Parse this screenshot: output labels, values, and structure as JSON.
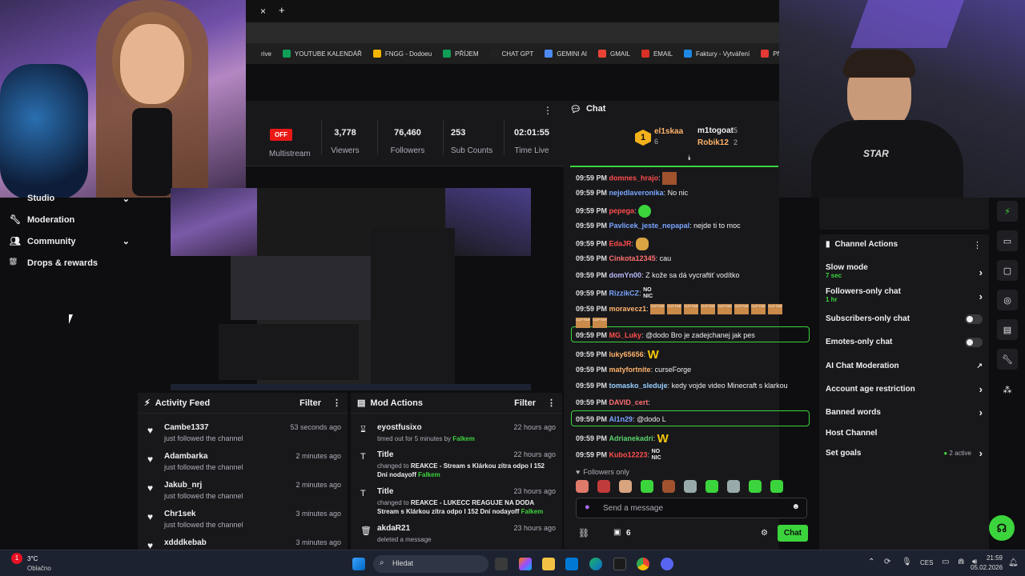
{
  "browser": {
    "new_tab": "+",
    "close_tab": "×",
    "bookmarks": [
      {
        "label": "rive",
        "color": "#1f1f1f"
      },
      {
        "label": "YOUTUBE KALENDÁŘ",
        "color": "#0f9d58"
      },
      {
        "label": "FNGG - Dodoeu",
        "color": "#f4b400"
      },
      {
        "label": "PŘÍJEM",
        "color": "#0f9d58"
      },
      {
        "label": "CHAT GPT",
        "color": "#222222"
      },
      {
        "label": "GEMINI AI",
        "color": "#4c8bf5"
      },
      {
        "label": "GMAIL",
        "color": "#ea4335"
      },
      {
        "label": "EMAIL",
        "color": "#d93025"
      },
      {
        "label": "Faktury - Vytváření",
        "color": "#1e88e5"
      },
      {
        "label": "PNG to PDF",
        "color": "#e53935"
      }
    ]
  },
  "stats": {
    "status": "OFF",
    "multistream": "Multistream",
    "viewers": {
      "value": "3,778",
      "label": "Viewers"
    },
    "followers": {
      "value": "76,460",
      "label": "Followers"
    },
    "subs": {
      "value": "253",
      "label": "Sub Counts"
    },
    "time": {
      "value": "02:01:55",
      "label": "Time Live"
    }
  },
  "sidebar": {
    "studio": "Studio",
    "moderation": "Moderation",
    "community": "Community",
    "drops": "Drops & rewards"
  },
  "activity": {
    "title": "Activity Feed",
    "filter": "Filter",
    "items": [
      {
        "name": "Cambe1337",
        "sub": "just followed the channel",
        "time": "53 seconds ago"
      },
      {
        "name": "Adambarka",
        "sub": "just followed the channel",
        "time": "2 minutes ago"
      },
      {
        "name": "Jakub_nrj",
        "sub": "just followed the channel",
        "time": "2 minutes ago"
      },
      {
        "name": "Chr1sek",
        "sub": "just followed the channel",
        "time": "3 minutes ago"
      },
      {
        "name": "xdddkebab",
        "sub": "",
        "time": "3 minutes ago"
      }
    ]
  },
  "mod_actions": {
    "title": "Mod Actions",
    "filter": "Filter",
    "items": [
      {
        "name": "eyostfusixo",
        "line1": "timed out for 5 minutes by",
        "by": "Falkem",
        "line2": "",
        "time": "22 hours ago"
      },
      {
        "name": "Title",
        "line1": "changed to",
        "bold1": "REAKCE - Stream s Klárkou zítra odpo I 152",
        "line2": "Dní nodayoff",
        "by": "Falkem",
        "time": "22 hours ago"
      },
      {
        "name": "Title",
        "line1": "changed to",
        "bold1": "REAKCE - LUKECC REAGUJE NA DODA",
        "line2": "Stream s Klárkou zítra odpo I 152 Dní nodayoff",
        "by": "Falkem",
        "time": "23 hours ago"
      },
      {
        "name": "akdaR21",
        "line1": "deleted a message",
        "by": "",
        "line2": "",
        "time": "23 hours ago"
      }
    ]
  },
  "chat": {
    "title": "Chat",
    "top": {
      "rank": "1",
      "first": "el1skaa",
      "first_count": "6",
      "second": "m1togoat",
      "second_count": "5",
      "third": "Robik12",
      "third_count": "2"
    },
    "messages": [
      {
        "time": "09:59 PM",
        "user": "domnes_hrajo",
        "color": "#ff4d4d",
        "text": ""
      },
      {
        "time": "09:59 PM",
        "user": "nejedlaveronika",
        "color": "#7aa6ff",
        "text": "No nic"
      },
      {
        "time": "09:59 PM",
        "user": "pepega",
        "color": "#ff4d4d",
        "text": ""
      },
      {
        "time": "09:59 PM",
        "user": "Pavlicek_jeste_nepapal",
        "color": "#7aa6ff",
        "text": "nejde ti to moc"
      },
      {
        "time": "09:59 PM",
        "user": "EdaJR",
        "color": "#ff4d4d",
        "text": ""
      },
      {
        "time": "09:59 PM",
        "user": "Cinkota12345",
        "color": "#ff7070",
        "text": "cau"
      },
      {
        "time": "09:59 PM",
        "user": "domYn00",
        "color": "#bbbbff",
        "text": "Z kože sa dá vycraftiť vodítko"
      },
      {
        "time": "09:59 PM",
        "user": "RizzikCZ",
        "color": "#7aa6ff",
        "text": ""
      },
      {
        "time": "09:59 PM",
        "user": "moravecz1",
        "color": "#ffb36b",
        "text": ""
      },
      {
        "time": "09:59 PM",
        "user": "MG_Luky",
        "color": "#ff4d4d",
        "text": "@dodo Bro je zadejchanej jak pes"
      },
      {
        "time": "09:59 PM",
        "user": "luky65656",
        "color": "#ffb36b",
        "text": ""
      },
      {
        "time": "09:59 PM",
        "user": "matyfortnite",
        "color": "#ffb36b",
        "text": "curseForge"
      },
      {
        "time": "09:59 PM",
        "user": "tomasko_sleduje",
        "color": "#9ad0ff",
        "text": "kedy vojde video Minecraft s klarkou"
      },
      {
        "time": "09:59 PM",
        "user": "DAVID_cert",
        "color": "#ff7070",
        "text": ""
      },
      {
        "time": "09:59 PM",
        "user": "Al1n29",
        "color": "#7aa6ff",
        "text": "@dodo L"
      },
      {
        "time": "09:59 PM",
        "user": "Adrianekadri",
        "color": "#5bd46b",
        "text": ""
      },
      {
        "time": "09:59 PM",
        "user": "Kubo12223",
        "color": "#ff4d4d",
        "text": ""
      }
    ],
    "emote_labels": {
      "nonic": "NO NIC",
      "clipfarm": "CLIP FARM",
      "w": "W"
    },
    "followers_only": "Followers only",
    "placeholder": "Send a message",
    "count": "6",
    "send": "Chat"
  },
  "channel_actions": {
    "title": "Channel Actions",
    "slow": "Slow mode",
    "slow_sub": "7 sec",
    "followers": "Followers-only chat",
    "followers_sub": "1 hr",
    "subs": "Subscribers-only chat",
    "emotes": "Emotes-only chat",
    "ai": "AI Chat Moderation",
    "age": "Account age restriction",
    "banned": "Banned words",
    "host": "Host Channel",
    "goals": "Set goals",
    "goals_sub": "2 active"
  },
  "taskbar": {
    "temp": "3°C",
    "weather": "Oblačno",
    "search": "Hledat",
    "lang": "CES",
    "time": "21:59",
    "date": "05.02.2026",
    "badge": "1"
  }
}
